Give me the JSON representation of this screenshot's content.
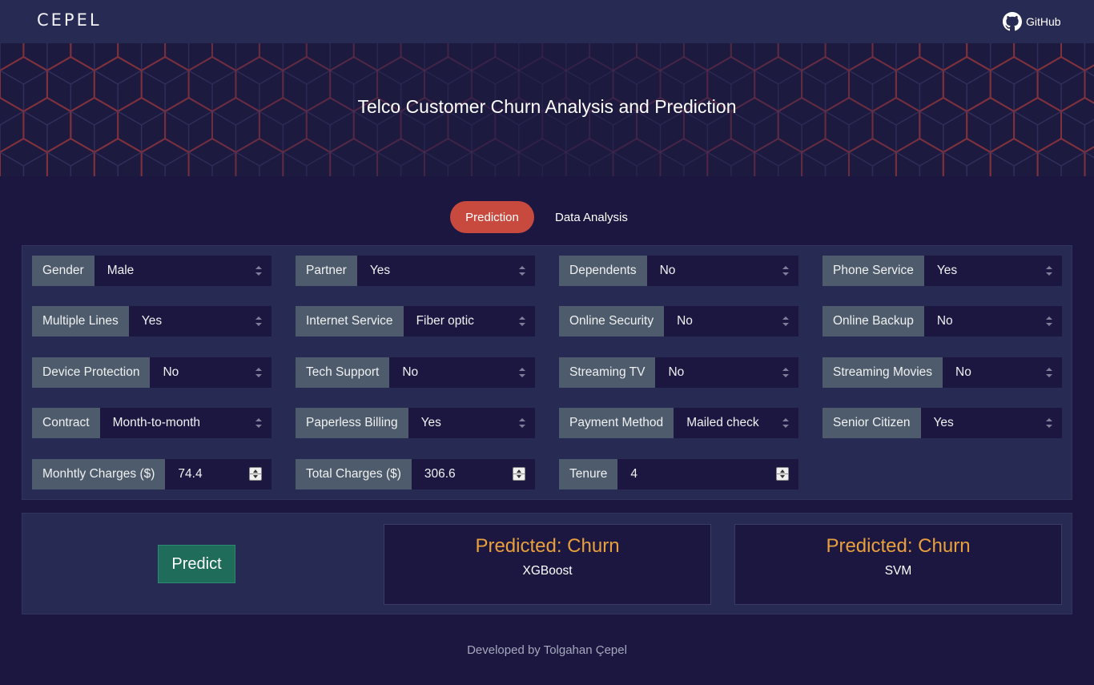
{
  "nav": {
    "brand": "CEPEL",
    "github_label": "GitHub"
  },
  "hero": {
    "title": "Telco Customer Churn Analysis and Prediction"
  },
  "tabs": [
    {
      "label": "Prediction",
      "active": true
    },
    {
      "label": "Data Analysis",
      "active": false
    }
  ],
  "fields": [
    {
      "label": "Gender",
      "value": "Male",
      "type": "select"
    },
    {
      "label": "Partner",
      "value": "Yes",
      "type": "select"
    },
    {
      "label": "Dependents",
      "value": "No",
      "type": "select"
    },
    {
      "label": "Phone Service",
      "value": "Yes",
      "type": "select"
    },
    {
      "label": "Multiple Lines",
      "value": "Yes",
      "type": "select"
    },
    {
      "label": "Internet Service",
      "value": "Fiber optic",
      "type": "select"
    },
    {
      "label": "Online Security",
      "value": "No",
      "type": "select"
    },
    {
      "label": "Online Backup",
      "value": "No",
      "type": "select"
    },
    {
      "label": "Device Protection",
      "value": "No",
      "type": "select"
    },
    {
      "label": "Tech Support",
      "value": "No",
      "type": "select"
    },
    {
      "label": "Streaming TV",
      "value": "No",
      "type": "select"
    },
    {
      "label": "Streaming Movies",
      "value": "No",
      "type": "select"
    },
    {
      "label": "Contract",
      "value": "Month-to-month",
      "type": "select"
    },
    {
      "label": "Paperless Billing",
      "value": "Yes",
      "type": "select"
    },
    {
      "label": "Payment Method",
      "value": "Mailed check",
      "type": "select"
    },
    {
      "label": "Senior Citizen",
      "value": "Yes",
      "type": "select"
    },
    {
      "label": "Monhtly Charges ($)",
      "value": "74.4",
      "type": "number"
    },
    {
      "label": "Total Charges ($)",
      "value": "306.6",
      "type": "number"
    },
    {
      "label": "Tenure",
      "value": "4",
      "type": "number"
    }
  ],
  "predict": {
    "button_label": "Predict"
  },
  "results": [
    {
      "title": "Predicted: Churn",
      "model": "XGBoost"
    },
    {
      "title": "Predicted: Churn",
      "model": "SVM"
    }
  ],
  "footer": {
    "text": "Developed by Tolgahan Çepel"
  },
  "colors": {
    "background": "#1b1741",
    "navbar": "#272a52",
    "active_tab": "#c84a3e",
    "label_bg": "#4d5b6c",
    "predict_button": "#1f6c5a",
    "result_text": "#e9a03c"
  }
}
